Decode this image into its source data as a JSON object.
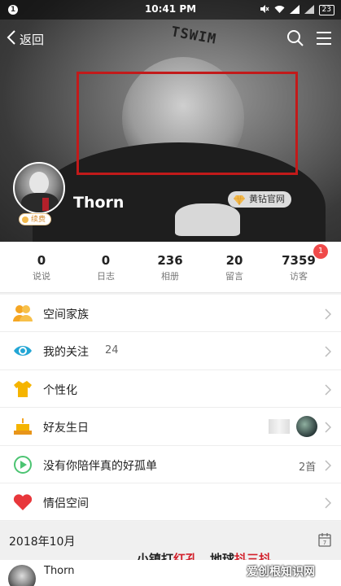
{
  "status_bar": {
    "notification_badge": "1",
    "time": "10:41 PM",
    "battery": "23",
    "icons": [
      "mute-icon",
      "wifi-icon",
      "signal-icon",
      "signal-icon",
      "battery-icon"
    ]
  },
  "nav": {
    "back_label": "返回"
  },
  "cover": {
    "tattoo_text": "TSWIM"
  },
  "profile": {
    "name": "Thorn",
    "renew_label": "续费",
    "vip_badge": "黄钻官网"
  },
  "stats": [
    {
      "value": "0",
      "label": "说说"
    },
    {
      "value": "0",
      "label": "日志"
    },
    {
      "value": "236",
      "label": "相册"
    },
    {
      "value": "20",
      "label": "留言"
    },
    {
      "value": "7359",
      "label": "访客"
    }
  ],
  "visitor_badge": "1",
  "menu": [
    {
      "label": "空间家族",
      "icon": "family-icon",
      "extra": ""
    },
    {
      "label": "我的关注",
      "icon": "eye-icon",
      "extra": "24"
    },
    {
      "label": "个性化",
      "icon": "shirt-icon",
      "extra": ""
    },
    {
      "label": "好友生日",
      "icon": "cake-icon",
      "extra": ""
    },
    {
      "label": "没有你陪伴真的好孤单",
      "icon": "play-icon",
      "extra": "2首"
    },
    {
      "label": "情侣空间",
      "icon": "heart-icon",
      "extra": ""
    }
  ],
  "timeline": {
    "date_header": "2018年10月"
  },
  "post": {
    "author": "Thorn"
  },
  "watermarks": {
    "line1_a": "小镇打",
    "line1_b": "红孔",
    "line1_c": "，地球",
    "line1_d": "抖三抖",
    "line2": "爱创根知识网"
  },
  "colors": {
    "accent_red": "#c21a1a",
    "badge_red": "#f04a4a",
    "vip_gold": "#f2b84b"
  }
}
